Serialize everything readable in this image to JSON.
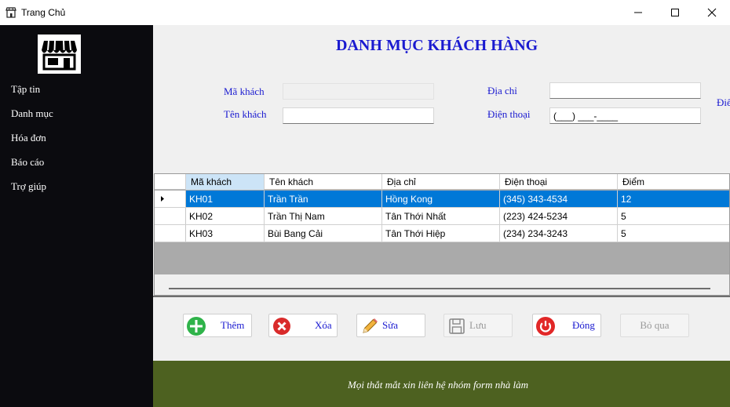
{
  "window": {
    "title": "Trang Chủ",
    "controls": [
      "minimize-icon",
      "maximize-icon",
      "close-icon"
    ]
  },
  "sidebar": {
    "logo_icon": "store-icon",
    "items": [
      {
        "label": "Tập tin"
      },
      {
        "label": "Danh mục"
      },
      {
        "label": "Hóa đơn"
      },
      {
        "label": "Báo cáo"
      },
      {
        "label": "Trợ giúp"
      }
    ]
  },
  "form": {
    "title": "DANH MỤC KHÁCH HÀNG",
    "ma_khach": {
      "label": "Mã khách",
      "value": ""
    },
    "ten_khach": {
      "label": "Tên khách",
      "value": ""
    },
    "dia_chi": {
      "label": "Địa chỉ",
      "value": ""
    },
    "dien_thoai": {
      "label": "Điện thoại",
      "value": "(___) ___-____"
    },
    "diem": {
      "label": "Điể"
    }
  },
  "grid": {
    "columns": [
      "Mã khách",
      "Tên khách",
      "Địa chỉ",
      "Điện thoại",
      "Điểm"
    ],
    "rows": [
      {
        "ma": "KH01",
        "ten": "Trần Trần",
        "dia_chi": "Hồng Kong",
        "dien_thoai": "(345) 343-4534",
        "diem": "12"
      },
      {
        "ma": "KH02",
        "ten": "Trần Thị Nam",
        "dia_chi": "Tân Thới Nhất",
        "dien_thoai": "(223) 424-5234",
        "diem": "5"
      },
      {
        "ma": "KH03",
        "ten": "Bùi Bang Cải",
        "dia_chi": "Tân Thới Hiệp",
        "dien_thoai": "(234) 234-3243",
        "diem": "5"
      }
    ],
    "selected_row": 0
  },
  "buttons": {
    "them": {
      "label": "Thêm",
      "icon": "plus-circle-icon"
    },
    "xoa": {
      "label": "Xóa",
      "icon": "delete-x-icon"
    },
    "sua": {
      "label": "Sửa",
      "icon": "pencil-icon"
    },
    "luu": {
      "label": "Lưu",
      "icon": "save-disk-icon"
    },
    "dong": {
      "label": "Đóng",
      "icon": "power-icon"
    },
    "bo_qua": {
      "label": "Bỏ qua"
    }
  },
  "footer": {
    "text": "Mọi thắt mắt xin liên hệ nhóm form nhà làm"
  },
  "colors": {
    "sidebar_bg": "#0b0b0f",
    "label_blue": "#1a1ad0",
    "selection_blue": "#0078d7",
    "footer_green": "#4d6120"
  }
}
